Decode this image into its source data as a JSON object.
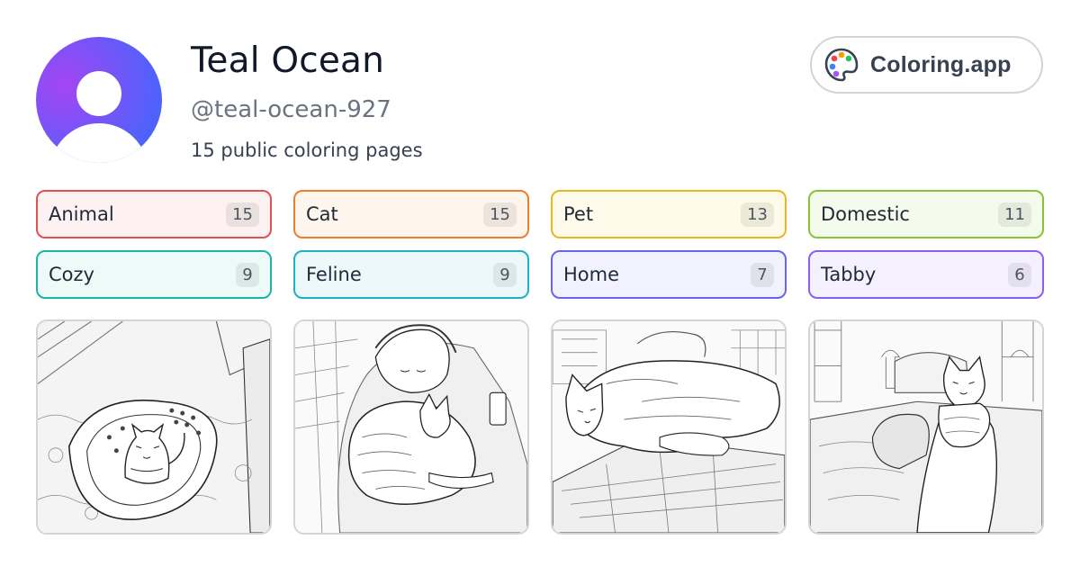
{
  "profile": {
    "name": "Teal Ocean",
    "handle": "@teal-ocean-927",
    "page_count_text": "15 public coloring pages",
    "avatar_icon": "user-silhouette-icon"
  },
  "brand": {
    "label": "Coloring.app",
    "icon": "palette-icon",
    "palette_colors": [
      "#ef4444",
      "#f59e0b",
      "#22c55e",
      "#3b82f6",
      "#a855f7"
    ]
  },
  "tags": [
    {
      "label": "Animal",
      "count": "15",
      "border": "#e05252",
      "bg": "#fdf1f1"
    },
    {
      "label": "Cat",
      "count": "15",
      "border": "#ee7d2c",
      "bg": "#fef5ec"
    },
    {
      "label": "Pet",
      "count": "13",
      "border": "#e6b81e",
      "bg": "#fefbea"
    },
    {
      "label": "Domestic",
      "count": "11",
      "border": "#86c531",
      "bg": "#f5fbec"
    },
    {
      "label": "Cozy",
      "count": "9",
      "border": "#1cb3a8",
      "bg": "#edfaf8"
    },
    {
      "label": "Feline",
      "count": "9",
      "border": "#1eb0c4",
      "bg": "#ecf9fb"
    },
    {
      "label": "Home",
      "count": "7",
      "border": "#6366f1",
      "bg": "#f1f2fd"
    },
    {
      "label": "Tabby",
      "count": "6",
      "border": "#8b5cf6",
      "bg": "#f5f0fe"
    }
  ],
  "thumbnails": [
    {
      "subject": "cat-in-laundry-basket-drawing"
    },
    {
      "subject": "cat-sleeping-with-girl-drawing"
    },
    {
      "subject": "cat-lounging-on-bed-drawing"
    },
    {
      "subject": "cat-held-in-bedroom-drawing"
    }
  ]
}
